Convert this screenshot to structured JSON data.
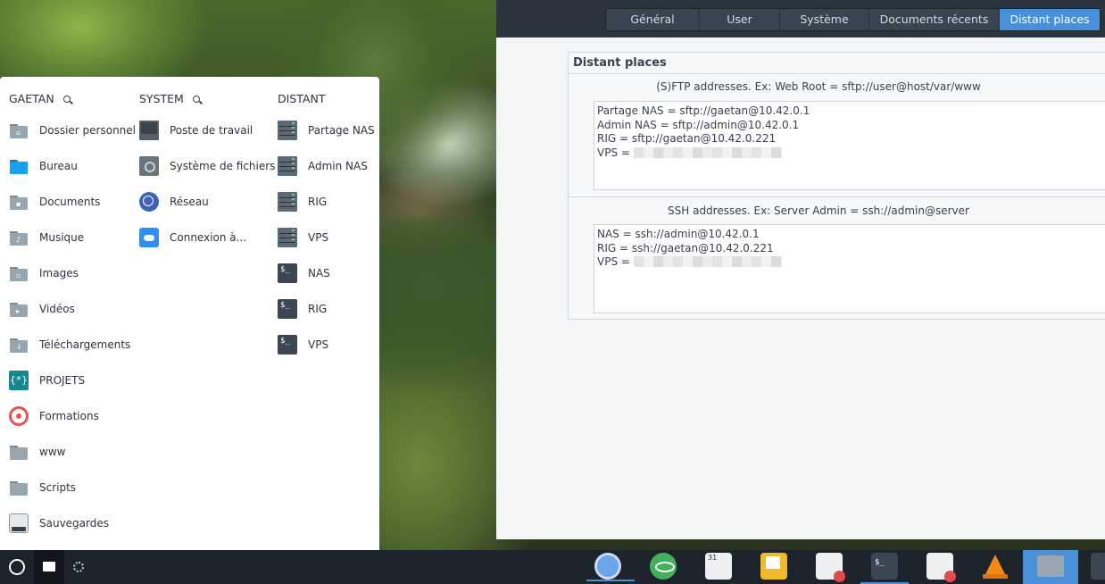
{
  "settings": {
    "tabs": [
      {
        "label": "Général",
        "active": false
      },
      {
        "label": "User",
        "active": false
      },
      {
        "label": "Système",
        "active": false
      },
      {
        "label": "Documents récents",
        "active": false
      },
      {
        "label": "Distant places",
        "active": true
      }
    ],
    "places_title": "Distant places",
    "sftp": {
      "label": "(S)FTP addresses. Ex: Web Root = sftp://user@host/var/www",
      "lines": [
        "Partage NAS = sftp://gaetan@10.42.0.1",
        "Admin NAS = sftp://admin@10.42.0.1",
        "RIG = sftp://gaetan@10.42.0.221",
        "VPS = "
      ]
    },
    "ssh": {
      "label": "SSH addresses. Ex: Server Admin = ssh://admin@server",
      "lines": [
        "NAS = ssh://admin@10.42.0.1",
        "RIG = ssh://gaetan@10.42.0.221",
        "VPS = "
      ]
    }
  },
  "launcher": {
    "columns": [
      {
        "heading": "GAETAN",
        "search_icon": true,
        "items": [
          {
            "label": "Dossier personnel",
            "icon": "home-folder-icon"
          },
          {
            "label": "Bureau",
            "icon": "desktop-folder-icon"
          },
          {
            "label": "Documents",
            "icon": "documents-folder-icon"
          },
          {
            "label": "Musique",
            "icon": "music-folder-icon"
          },
          {
            "label": "Images",
            "icon": "pictures-folder-icon"
          },
          {
            "label": "Vidéos",
            "icon": "videos-folder-icon"
          },
          {
            "label": "Téléchargements",
            "icon": "downloads-folder-icon"
          },
          {
            "label": "PROJETS",
            "icon": "brackets-icon"
          },
          {
            "label": "Formations",
            "icon": "target-icon"
          },
          {
            "label": "www",
            "icon": "folder-icon"
          },
          {
            "label": "Scripts",
            "icon": "folder-icon"
          },
          {
            "label": "Sauvegardes",
            "icon": "drive-icon"
          }
        ]
      },
      {
        "heading": "SYSTEM",
        "search_icon": true,
        "items": [
          {
            "label": "Poste de travail",
            "icon": "computer-icon"
          },
          {
            "label": "Système de fichiers",
            "icon": "harddisk-icon"
          },
          {
            "label": "Réseau",
            "icon": "network-globe-icon"
          },
          {
            "label": "Connexion à...",
            "icon": "cloud-icon"
          }
        ]
      },
      {
        "heading": "DISTANT",
        "search_icon": false,
        "items": [
          {
            "label": "Partage NAS",
            "icon": "server-icon"
          },
          {
            "label": "Admin NAS",
            "icon": "server-icon"
          },
          {
            "label": "RIG",
            "icon": "server-icon"
          },
          {
            "label": "VPS",
            "icon": "server-icon"
          },
          {
            "label": "NAS",
            "icon": "terminal-icon"
          },
          {
            "label": "RIG",
            "icon": "terminal-icon"
          },
          {
            "label": "VPS",
            "icon": "terminal-icon"
          }
        ]
      }
    ]
  },
  "icons": {
    "term_glyph": "$_",
    "brackets_glyph": "{*}",
    "calendar_glyph": "31"
  },
  "colors": {
    "accent": "#4a90d9",
    "taskbar": "#1d232b",
    "settings_header": "#2c3440"
  }
}
